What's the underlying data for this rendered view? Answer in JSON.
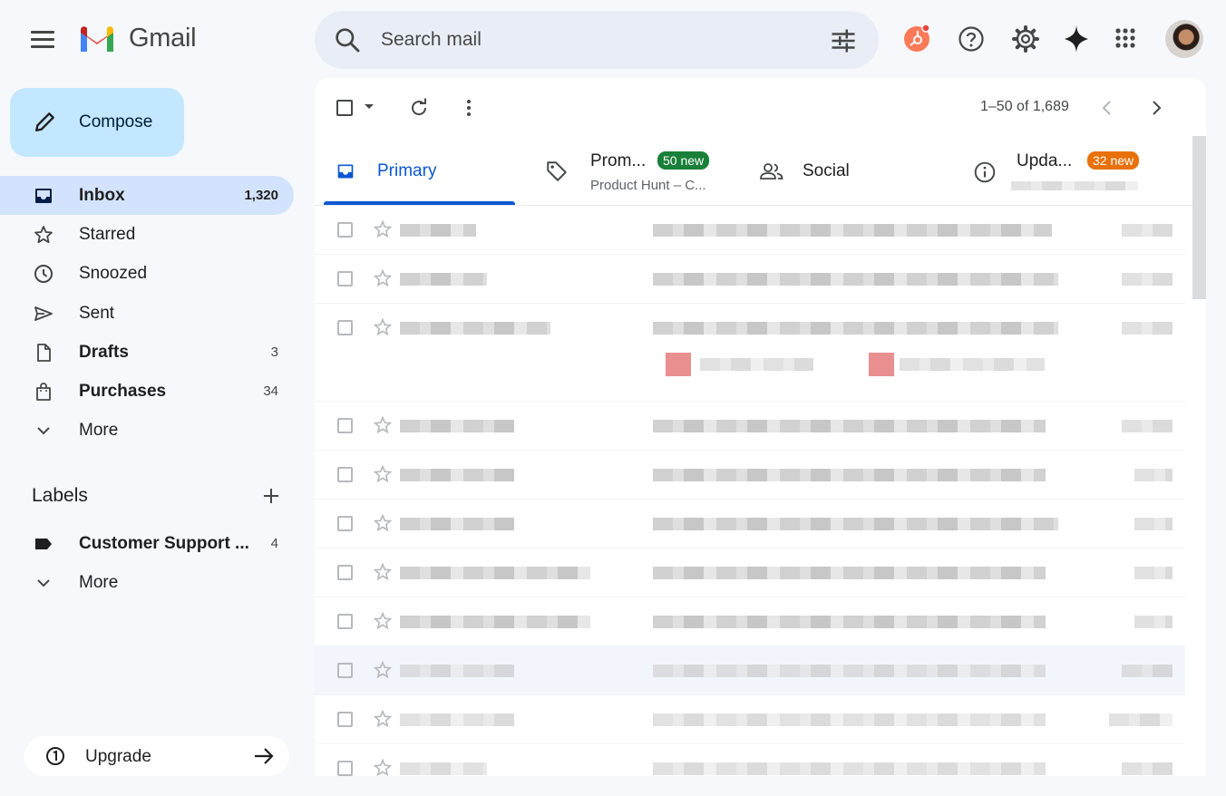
{
  "app": {
    "brand": "Gmail"
  },
  "search": {
    "placeholder": "Search mail"
  },
  "compose": {
    "label": "Compose"
  },
  "nav": {
    "items": [
      {
        "label": "Inbox",
        "count": "1,320"
      },
      {
        "label": "Starred",
        "count": ""
      },
      {
        "label": "Snoozed",
        "count": ""
      },
      {
        "label": "Sent",
        "count": ""
      },
      {
        "label": "Drafts",
        "count": "3"
      },
      {
        "label": "Purchases",
        "count": "34"
      },
      {
        "label": "More",
        "count": ""
      }
    ]
  },
  "labels": {
    "title": "Labels",
    "items": [
      {
        "label": "Customer Support ...",
        "count": "4"
      },
      {
        "label": "More",
        "count": ""
      }
    ]
  },
  "upgrade": {
    "label": "Upgrade"
  },
  "toolbar": {
    "pagination": "1–50 of 1,689"
  },
  "tabs": [
    {
      "label": "Primary",
      "badge": "",
      "sub": ""
    },
    {
      "label": "Prom...",
      "badge": "50 new",
      "sub": "Product Hunt – C..."
    },
    {
      "label": "Social",
      "badge": "",
      "sub": ""
    },
    {
      "label": "Upda...",
      "badge": "32 new",
      "sub": ""
    }
  ],
  "colors": {
    "accent": "#0b57d0",
    "active_nav": "#d3e3fd",
    "compose": "#c2e7ff",
    "promotions_badge": "#188038",
    "updates_badge": "#e8710a",
    "hubspot": "#ff7a59"
  },
  "icons": {
    "menu": "hamburger-icon",
    "search": "search-icon",
    "filter": "tune-icon",
    "help": "help-icon",
    "settings": "gear-icon",
    "gemini": "sparkle-icon",
    "apps": "apps-grid-icon"
  }
}
